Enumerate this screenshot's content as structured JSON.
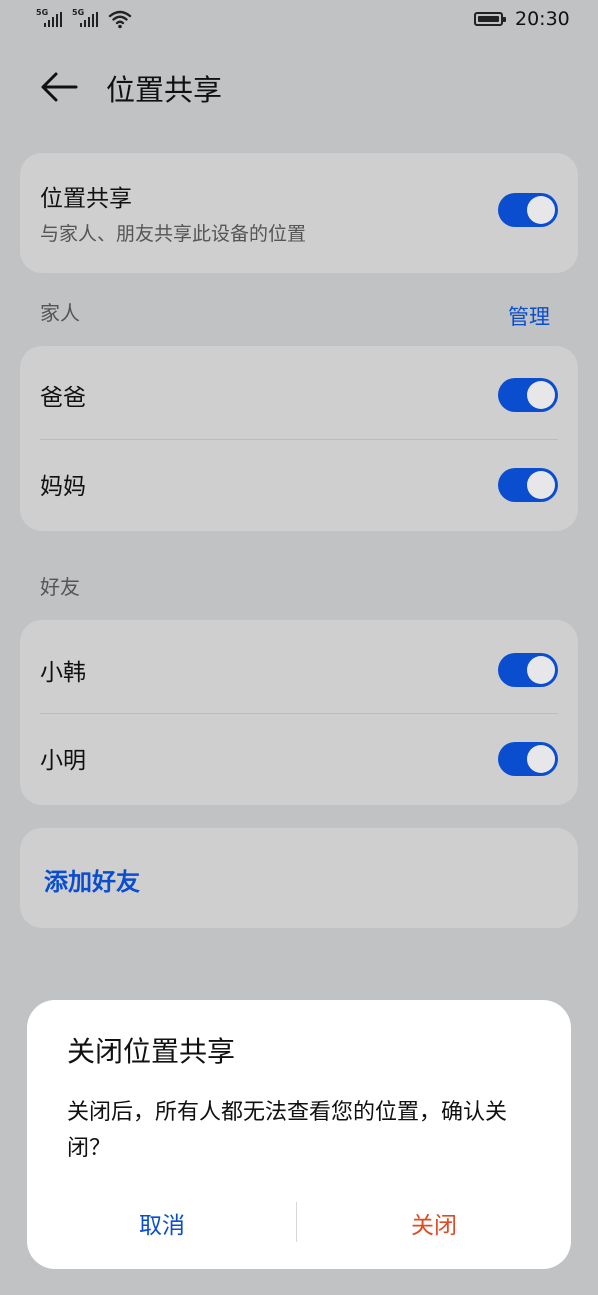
{
  "status_bar": {
    "sim1_label": "5G",
    "sim2_label": "5G",
    "time": "20:30",
    "icons": [
      "signal-icon",
      "signal-icon",
      "wifi-icon",
      "battery-icon"
    ]
  },
  "header": {
    "back_icon": "arrow-left-icon",
    "title": "位置共享"
  },
  "location_sharing": {
    "title": "位置共享",
    "subtitle": "与家人、朋友共享此设备的位置",
    "enabled": true
  },
  "family": {
    "label": "家人",
    "manage_label": "管理",
    "members": [
      {
        "name": "爸爸",
        "enabled": true
      },
      {
        "name": "妈妈",
        "enabled": true
      }
    ]
  },
  "friends": {
    "label": "好友",
    "members": [
      {
        "name": "小韩",
        "enabled": true
      },
      {
        "name": "小明",
        "enabled": true
      }
    ],
    "add_label": "添加好友"
  },
  "dialog": {
    "title": "关闭位置共享",
    "message": "关闭后，所有人都无法查看您的位置，确认关闭？",
    "cancel_label": "取消",
    "confirm_label": "关闭"
  },
  "colors": {
    "accent": "#0a4ecf",
    "danger": "#e04b25",
    "background": "#c1c2c4",
    "card": "#cfcfd0"
  }
}
